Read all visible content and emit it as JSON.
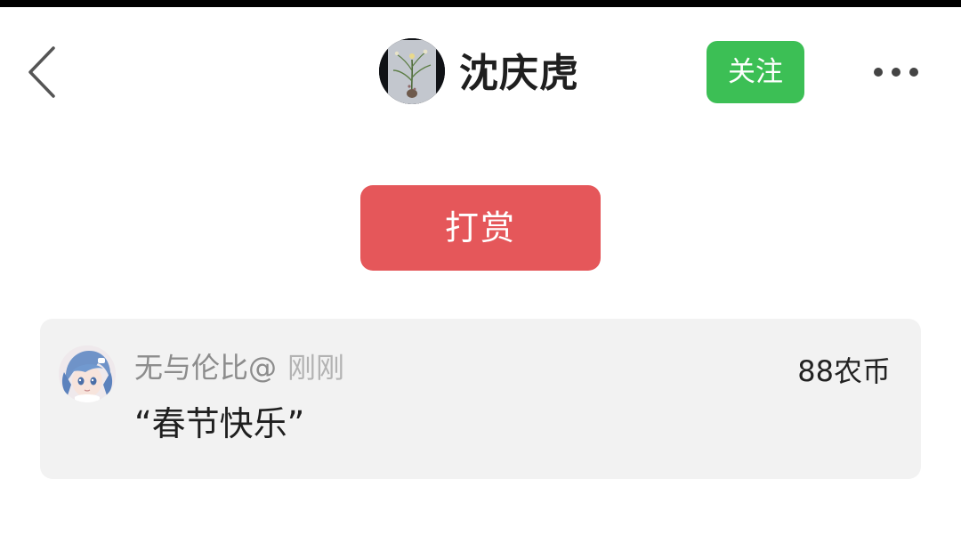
{
  "header": {
    "author_name": "沈庆虎",
    "follow_label": "关注",
    "back_icon": "chevron-left-icon",
    "more_icon": "more-dots-icon"
  },
  "tip": {
    "button_label": "打赏"
  },
  "tip_records": [
    {
      "user": "无与伦比@",
      "time": "刚刚",
      "amount": "88农币",
      "message": "“春节快乐”"
    }
  ],
  "colors": {
    "follow_green": "#3cbf55",
    "tip_red": "#e5575a",
    "card_background": "#f2f2f2"
  }
}
